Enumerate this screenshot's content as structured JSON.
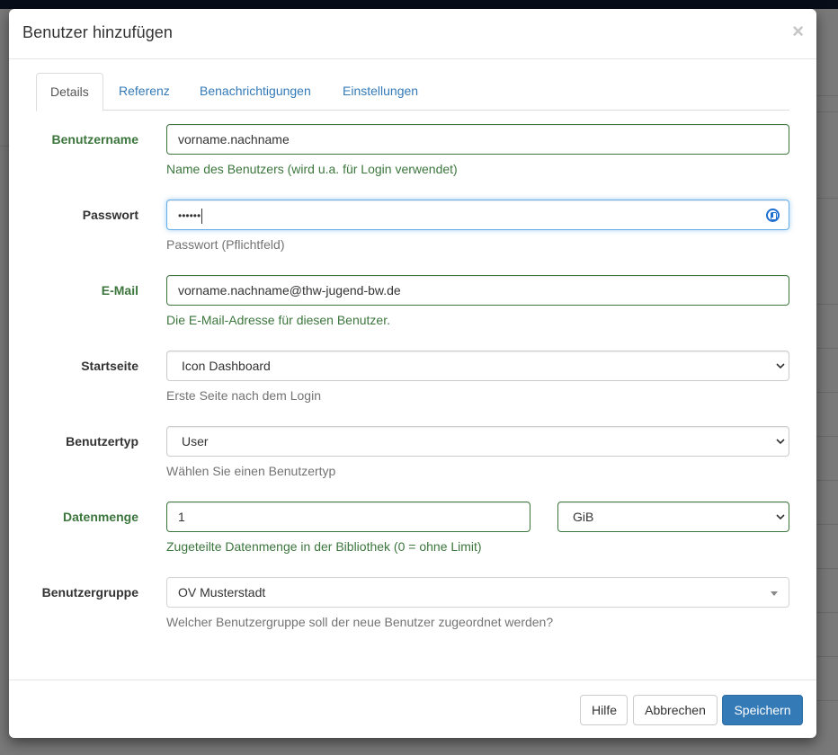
{
  "modal": {
    "title": "Benutzer hinzufügen",
    "close_glyph": "×"
  },
  "tabs": [
    {
      "label": "Details",
      "active": true
    },
    {
      "label": "Referenz",
      "active": false
    },
    {
      "label": "Benachrichtigungen",
      "active": false
    },
    {
      "label": "Einstellungen",
      "active": false
    }
  ],
  "form": {
    "username": {
      "label": "Benutzername",
      "value": "vorname.nachname",
      "help": "Name des Benutzers (wird u.a. für Login verwendet)"
    },
    "password": {
      "label": "Passwort",
      "value": "••••••",
      "help": "Passwort (Pflichtfeld)",
      "icon": "password-manager-icon"
    },
    "email": {
      "label": "E-Mail",
      "value": "vorname.nachname@thw-jugend-bw.de",
      "help": "Die E-Mail-Adresse für diesen Benutzer."
    },
    "startpage": {
      "label": "Startseite",
      "value": "Icon Dashboard",
      "help": "Erste Seite nach dem Login"
    },
    "usertype": {
      "label": "Benutzertyp",
      "value": "User",
      "help": "Wählen Sie einen Benutzertyp"
    },
    "quota": {
      "label": "Datenmenge",
      "value": "1",
      "unit": "GiB",
      "help": "Zugeteilte Datenmenge in der Bibliothek (0 = ohne Limit)"
    },
    "usergroup": {
      "label": "Benutzergruppe",
      "value": "OV Musterstadt",
      "help": "Welcher Benutzergruppe soll der neue Benutzer zugeordnet werden?"
    }
  },
  "footer": {
    "help_label": "Hilfe",
    "cancel_label": "Abbrechen",
    "save_label": "Speichern"
  },
  "colors": {
    "primary": "#337ab7",
    "success": "#3c763d",
    "focus": "#66afe9",
    "overlay_topbar": "#0f1b33"
  }
}
